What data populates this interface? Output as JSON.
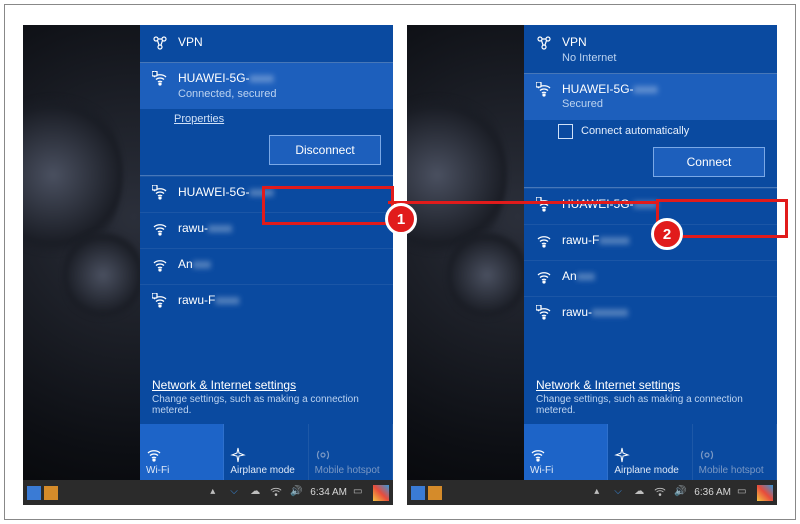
{
  "left": {
    "vpn": {
      "label": "VPN",
      "status": ""
    },
    "selected": {
      "name": "HUAWEI-5G-",
      "status": "Connected, secured",
      "properties": "Properties",
      "button": "Disconnect"
    },
    "networks": [
      {
        "name": "HUAWEI-5G-",
        "locked": true
      },
      {
        "name": "rawu-",
        "locked": false
      },
      {
        "name": "An",
        "locked": false
      },
      {
        "name": "rawu-F",
        "locked": true
      }
    ],
    "settings": {
      "title": "Network & Internet settings",
      "desc": "Change settings, such as making a connection metered."
    },
    "tiles": {
      "wifi": "Wi-Fi",
      "airplane": "Airplane mode",
      "hotspot": "Mobile hotspot"
    },
    "taskbar": {
      "time": "6:34 AM"
    }
  },
  "right": {
    "vpn": {
      "label": "VPN",
      "status": "No Internet"
    },
    "selected": {
      "name": "HUAWEI-5G-",
      "status": "Secured",
      "checkbox": "Connect automatically",
      "button": "Connect"
    },
    "networks": [
      {
        "name": "HUAWEI-5G-",
        "locked": true
      },
      {
        "name": "rawu-F",
        "locked": false
      },
      {
        "name": "An",
        "locked": false
      },
      {
        "name": "rawu-",
        "locked": true
      }
    ],
    "settings": {
      "title": "Network & Internet settings",
      "desc": "Change settings, such as making a connection metered."
    },
    "tiles": {
      "wifi": "Wi-Fi",
      "airplane": "Airplane mode",
      "hotspot": "Mobile hotspot"
    },
    "taskbar": {
      "time": "6:36 AM"
    }
  },
  "callouts": {
    "one": "1",
    "two": "2"
  }
}
